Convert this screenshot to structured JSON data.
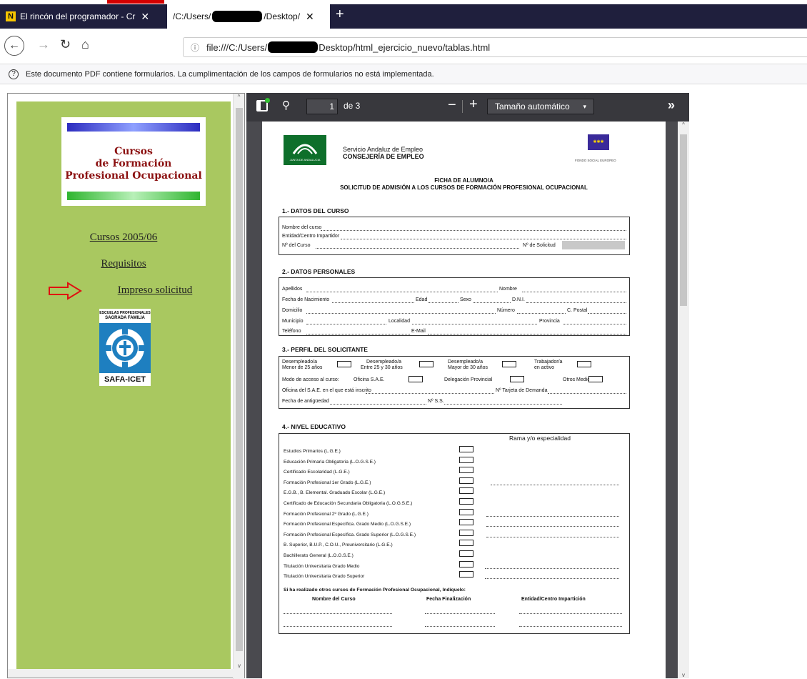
{
  "browser": {
    "tabs": [
      {
        "label": "El rincón del programador - Cr"
      },
      {
        "label_prefix": "/C:/Users/",
        "label_suffix": "/Desktop/"
      }
    ],
    "url_prefix": "file:///C:/Users/",
    "url_suffix": "Desktop/html_ejercicio_nuevo/tablas.html",
    "notice": "Este documento PDF contiene formularios. La cumplimentación de los campos de formularios no está implementada."
  },
  "left": {
    "logo_line1": "Cursos",
    "logo_line2": "de Formación",
    "logo_line3": "Profesional Ocupacional",
    "links": [
      "Cursos 2005/06",
      "Requisitos",
      "Impreso solicitud"
    ],
    "badge_top1": "ESCUELAS PROFESIONALES",
    "badge_top2": "SAGRADA FAMILIA",
    "badge_bottom": "SAFA-ICET"
  },
  "pdf_toolbar": {
    "page": "1",
    "of_pages": "de 3",
    "zoom": "Tamaño automático"
  },
  "pdf": {
    "junta": "JUNTA DE ANDALUCIA",
    "servicio": "Servicio Andaluz de Empleo",
    "consejeria": "CONSEJERÍA DE EMPLEO",
    "fondo": "FONDO SOCIAL EUROPEO",
    "title1": "FICHA DE ALUMNO/A",
    "title2": "SOLICITUD DE ADMISIÓN A LOS CURSOS DE FORMACIÓN PROFESIONAL OCUPACIONAL",
    "s1": "1.- DATOS DEL CURSO",
    "s1_nombre": "Nombre del curso",
    "s1_entidad": "Entidad/Centro Impartidor",
    "s1_num": "Nº del Curso",
    "s1_sol": "Nº de Solicitud",
    "s2": "2.- DATOS PERSONALES",
    "s2_apellidos": "Apellidos",
    "s2_nombre": "Nombre",
    "s2_fecha": "Fecha de Nacimiento",
    "s2_edad": "Edad",
    "s2_sexo": "Sexo",
    "s2_dni": "D.N.I.",
    "s2_domicilio": "Domicilio",
    "s2_numero": "Número",
    "s2_cp": "C. Postal",
    "s2_municipio": "Municipio",
    "s2_localidad": "Localidad",
    "s2_provincia": "Provincia",
    "s2_telefono": "Teléfono",
    "s2_email": "E-Mail",
    "s3": "3.- PERFIL DEL SOLICITANTE",
    "s3_d1a": "Desempleado/a",
    "s3_d1b": "Menor de 25 años",
    "s3_d2a": "Desempleado/a",
    "s3_d2b": "Entre 25 y 30 años",
    "s3_d3a": "Desempleado/a",
    "s3_d3b": "Mayor de 30 años",
    "s3_t1": "Trabajador/a",
    "s3_t2": "en activo",
    "s3_modo": "Modo de acceso al curso:",
    "s3_oficina": "Oficina S.A.E.",
    "s3_delegacion": "Delegación Provincial",
    "s3_otros": "Otros Medios",
    "s3_oficina_inscrito": "Oficina del S.A.E. en el que está inscrito",
    "s3_tarjeta": "Nº Tarjeta de Demanda",
    "s3_antiguedad": "Fecha de antigüedad",
    "s3_ss": "Nº S.S.",
    "s4": "4.- NIVEL EDUCATIVO",
    "s4_rama": "Rama y/o especialidad",
    "s4_items": [
      "Estudios Primarios (L.G.E.)",
      "Educación Primaria Obligatoria (L.O.G.S.E.)",
      "Certificado Escolaridad (L.G.E.)",
      "Formación Profesional 1er Grado (L.G.E.)",
      "E.G.B., B. Elemental. Graduado Escolar (L.G.E.)",
      "Certificado de Educación Secundaria Obligatoria (L.O.G.S.E.)",
      "Formación Profesional 2º Grado (L.G.E.)",
      "Formación Profesional Específica. Grado Medio (L.O.G.S.E.)",
      "Formación Profesional Específica. Grado Superior (L.O.G.S.E.)",
      "B. Superior, B.U.P., C.O.U., Preuniversitario (L.G.E.)",
      "Bachillerato General (L.O.G.S.E.)",
      "Titulación Universitaria Grado Medio",
      "Titulación Universitaria Grado Superior"
    ],
    "s4_otros": "Si ha realizado otros cursos de Formación Profesional Ocupacional, Indíquelo:",
    "s4_col1": "Nombre del Curso",
    "s4_col2": "Fecha Finalización",
    "s4_col3": "Entidad/Centro Impartición"
  }
}
